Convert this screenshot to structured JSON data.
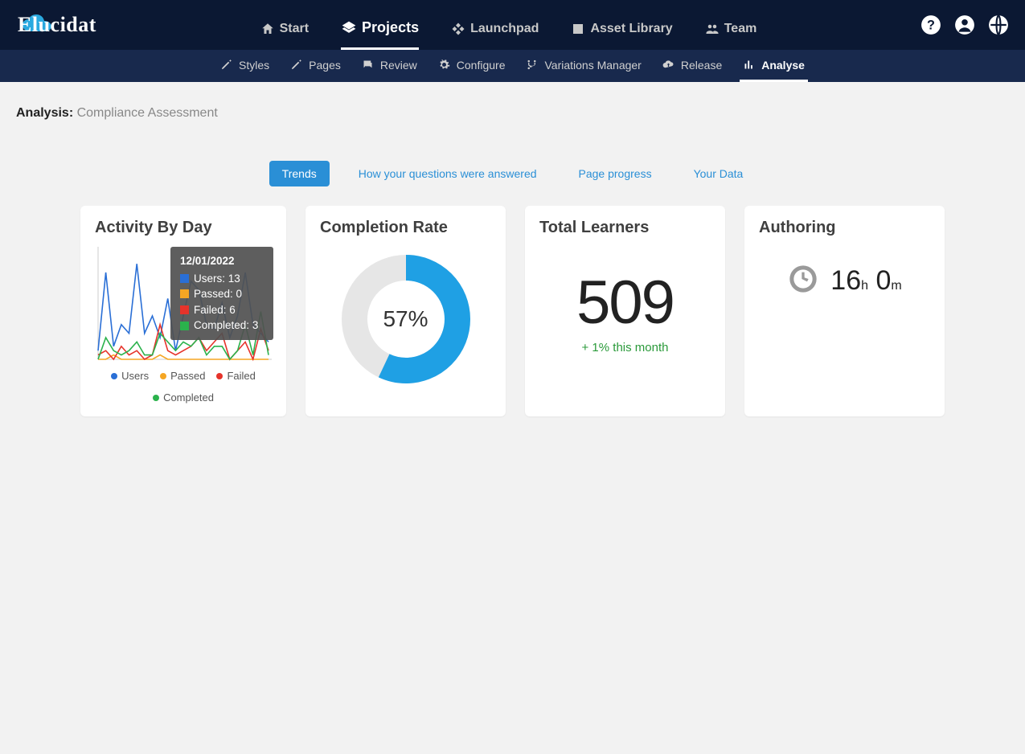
{
  "brand": "Elucidat",
  "nav": {
    "items": [
      {
        "label": "Start",
        "icon": "home"
      },
      {
        "label": "Projects",
        "icon": "layers",
        "active": true
      },
      {
        "label": "Launchpad",
        "icon": "diamond"
      },
      {
        "label": "Asset Library",
        "icon": "image"
      },
      {
        "label": "Team",
        "icon": "people"
      }
    ]
  },
  "subnav": {
    "items": [
      {
        "label": "Styles",
        "icon": "pencil"
      },
      {
        "label": "Pages",
        "icon": "pencil"
      },
      {
        "label": "Review",
        "icon": "chat"
      },
      {
        "label": "Configure",
        "icon": "gear"
      },
      {
        "label": "Variations Manager",
        "icon": "branch"
      },
      {
        "label": "Release",
        "icon": "cloud"
      },
      {
        "label": "Analyse",
        "icon": "bars",
        "active": true
      }
    ]
  },
  "page": {
    "title_prefix": "Analysis:",
    "title_name": "Compliance Assessment"
  },
  "tabs": [
    {
      "label": "Trends",
      "selected": true
    },
    {
      "label": "How your questions were answered"
    },
    {
      "label": "Page progress"
    },
    {
      "label": "Your Data"
    }
  ],
  "cards": {
    "activity": {
      "title": "Activity By Day",
      "tooltip": {
        "date": "12/01/2022",
        "series": [
          {
            "name": "Users",
            "value": 13,
            "color": "#2a6fd6"
          },
          {
            "name": "Passed",
            "value": 0,
            "color": "#f5a623"
          },
          {
            "name": "Failed",
            "value": 6,
            "color": "#e6332a"
          },
          {
            "name": "Completed",
            "value": 3,
            "color": "#2bb24c"
          }
        ]
      },
      "legend": [
        {
          "name": "Users",
          "color": "#2a6fd6"
        },
        {
          "name": "Passed",
          "color": "#f5a623"
        },
        {
          "name": "Failed",
          "color": "#e6332a"
        },
        {
          "name": "Completed",
          "color": "#2bb24c"
        }
      ]
    },
    "completion": {
      "title": "Completion Rate",
      "percent": 57,
      "percent_label": "57%"
    },
    "learners": {
      "title": "Total Learners",
      "value": "509",
      "delta": "+ 1% this month"
    },
    "authoring": {
      "title": "Authoring",
      "hours": "16",
      "h_unit": "h",
      "mins": "0",
      "m_unit": "m"
    }
  },
  "chart_data": {
    "type": "line",
    "title": "Activity By Day",
    "xlabel": "",
    "ylabel": "",
    "ylim": [
      0,
      25
    ],
    "series": [
      {
        "name": "Users",
        "color": "#2a6fd6",
        "values": [
          2,
          20,
          3,
          8,
          6,
          22,
          6,
          10,
          5,
          14,
          2,
          10,
          18,
          16,
          8,
          7,
          13,
          5,
          10,
          20,
          8,
          6,
          4
        ]
      },
      {
        "name": "Passed",
        "color": "#f5a623",
        "values": [
          0,
          0,
          1,
          0,
          0,
          0,
          0,
          0,
          1,
          0,
          0,
          0,
          0,
          0,
          0,
          0,
          0,
          0,
          0,
          0,
          0,
          0,
          0
        ]
      },
      {
        "name": "Failed",
        "color": "#e6332a",
        "values": [
          1,
          2,
          0,
          3,
          1,
          2,
          0,
          1,
          8,
          2,
          1,
          2,
          3,
          5,
          2,
          4,
          6,
          0,
          2,
          4,
          0,
          7,
          2
        ]
      },
      {
        "name": "Completed",
        "color": "#2bb24c",
        "values": [
          0,
          5,
          2,
          1,
          2,
          4,
          1,
          1,
          6,
          4,
          2,
          4,
          3,
          5,
          1,
          3,
          3,
          0,
          2,
          8,
          1,
          11,
          1
        ]
      }
    ]
  }
}
